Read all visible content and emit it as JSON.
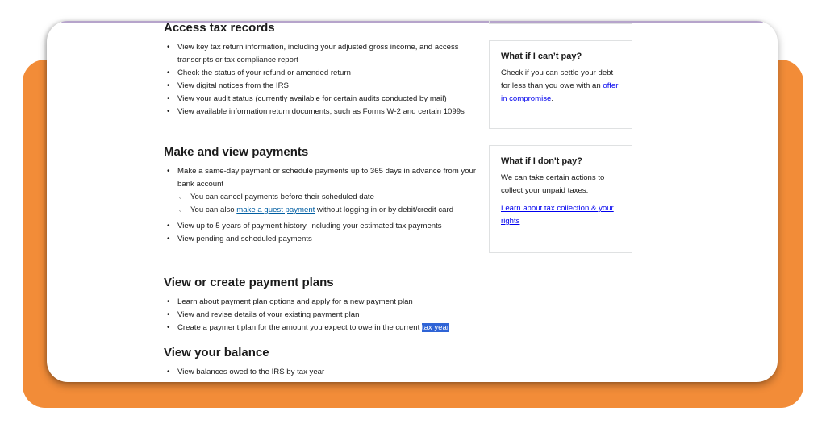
{
  "sections": {
    "access": {
      "heading": "Access tax records",
      "items": [
        "View key tax return information, including your adjusted gross income, and access transcripts or tax compliance report",
        "Check the status of your refund or amended return",
        "View digital notices from the IRS",
        "View your audit status (currently available for certain audits conducted by mail)",
        "View available information return documents, such as Forms W-2 and certain 1099s"
      ]
    },
    "payments": {
      "heading": "Make and view payments",
      "item1": "Make a same-day payment or schedule payments up to 365 days in advance from your bank account",
      "sub1": "You can cancel payments before their scheduled date",
      "sub2_prefix": "You can also ",
      "sub2_link": "make a guest payment",
      "sub2_suffix": " without logging in or by debit/credit card",
      "item2": "View up to 5 years of payment history, including your estimated tax payments",
      "item3": "View pending and scheduled payments"
    },
    "plans": {
      "heading": "View or create payment plans",
      "item1": "Learn about payment plan options and apply for a new payment plan",
      "item2": "View and revise details of your existing payment plan",
      "item3_prefix": "Create a payment plan for the amount you expect to owe in the current ",
      "item3_highlight": "tax year"
    },
    "balance": {
      "heading": "View your balance",
      "item1": "View balances owed to the IRS by tax year"
    }
  },
  "sidebar": {
    "cant_pay": {
      "title": "What if I can’t pay?",
      "text": "Check if you can settle your debt for less than you owe with an ",
      "link": "offer in compromise",
      "suffix": "."
    },
    "dont_pay": {
      "title": "What if I don't pay?",
      "text": "We can take certain actions to collect your unpaid taxes.",
      "link": "Learn about tax collection & your rights"
    }
  },
  "colors": {
    "frame_accent": "#f28c38",
    "link": "#005ea2",
    "selection_highlight": "#2f64d6"
  }
}
